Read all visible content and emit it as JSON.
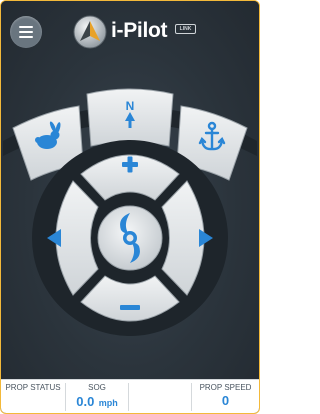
{
  "header": {
    "menu_icon": "hamburger-menu-icon",
    "logo_text": "i-Pilot",
    "logo_badge": "LINK"
  },
  "controls": {
    "heading_lock_label": "N",
    "heading_lock_icon": "north-arrow-icon",
    "speed_mode_icon": "rabbit-icon",
    "anchor_icon": "anchor-icon",
    "speed_up_icon": "plus-icon",
    "speed_down_icon": "minus-icon",
    "steer_left_icon": "left-arrow-icon",
    "steer_right_icon": "right-arrow-icon",
    "prop_toggle_icon": "propeller-icon"
  },
  "status": {
    "prop_status_label": "PROP STATUS",
    "sog_label": "SOG",
    "sog_value": "0.0",
    "sog_unit": "mph",
    "prop_speed_label": "PROP SPEED",
    "prop_speed_value": "0"
  },
  "colors": {
    "background": "#2b343c",
    "button_face": "#e4e7e9",
    "accent_blue": "#2a86d6",
    "frame_border": "#f3b93a"
  }
}
